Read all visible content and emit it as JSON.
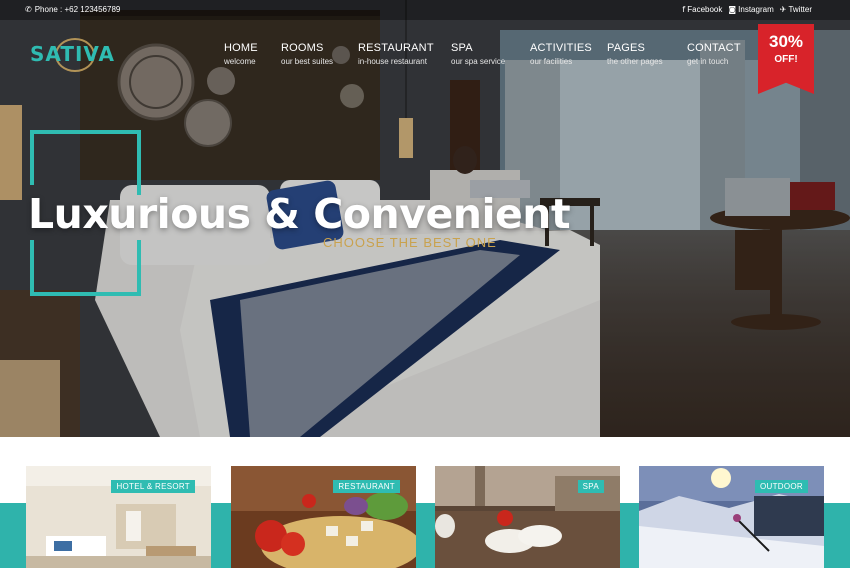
{
  "topbar": {
    "phone_icon": "phone-icon",
    "phone": "Phone : +62 123456789",
    "social": [
      {
        "icon": "facebook-icon",
        "label": "Facebook"
      },
      {
        "icon": "instagram-icon",
        "label": "Instagram"
      },
      {
        "icon": "twitter-icon",
        "label": "Twitter"
      }
    ]
  },
  "logo": {
    "text": "SATIVA"
  },
  "nav": [
    {
      "label": "HOME",
      "sub": "welcome"
    },
    {
      "label": "ROOMS",
      "sub": "our best suites"
    },
    {
      "label": "RESTAURANT",
      "sub": "in-house restaurant"
    },
    {
      "label": "SPA",
      "sub": "our spa service"
    },
    {
      "label": "ACTIVITIES",
      "sub": "our facilities"
    },
    {
      "label": "PAGES",
      "sub": "the other pages"
    },
    {
      "label": "CONTACT",
      "sub": "get in touch"
    }
  ],
  "badge": {
    "percent": "30%",
    "off": "OFF!"
  },
  "hero": {
    "headline": "Luxurious & Convenient",
    "tagline": "CHOOSE THE BEST ONE"
  },
  "cards": [
    {
      "tag": "HOTEL & RESORT"
    },
    {
      "tag": "RESTAURANT"
    },
    {
      "tag": "SPA"
    },
    {
      "tag": "OUTDOOR"
    }
  ],
  "colors": {
    "accent": "#2fbcb2",
    "badge": "#d8232a",
    "tagline": "#c9a24e"
  }
}
